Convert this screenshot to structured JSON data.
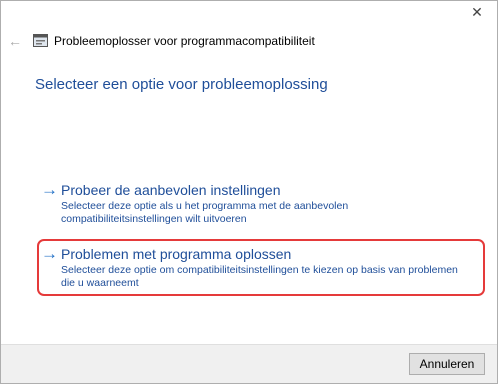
{
  "window": {
    "title": "Probleemoplosser voor programmacompatibiliteit",
    "close_symbol": "✕",
    "back_symbol": "←"
  },
  "heading": "Selecteer een optie voor probleemoplossing",
  "options": [
    {
      "title": "Probeer de aanbevolen instellingen",
      "description": "Selecteer deze optie als u het programma met de aanbevolen compatibiliteitsinstellingen wilt uitvoeren",
      "icon": "arrow-right-icon"
    },
    {
      "title": "Problemen met programma oplossen",
      "description": "Selecteer deze optie om compatibiliteitsinstellingen te kiezen op basis van problemen die u waarneemt",
      "icon": "arrow-right-icon"
    }
  ],
  "footer": {
    "cancel_label": "Annuleren"
  },
  "colors": {
    "accent": "#1f4e99",
    "arrow": "#1f6fc6",
    "highlight": "#e53a3a"
  }
}
